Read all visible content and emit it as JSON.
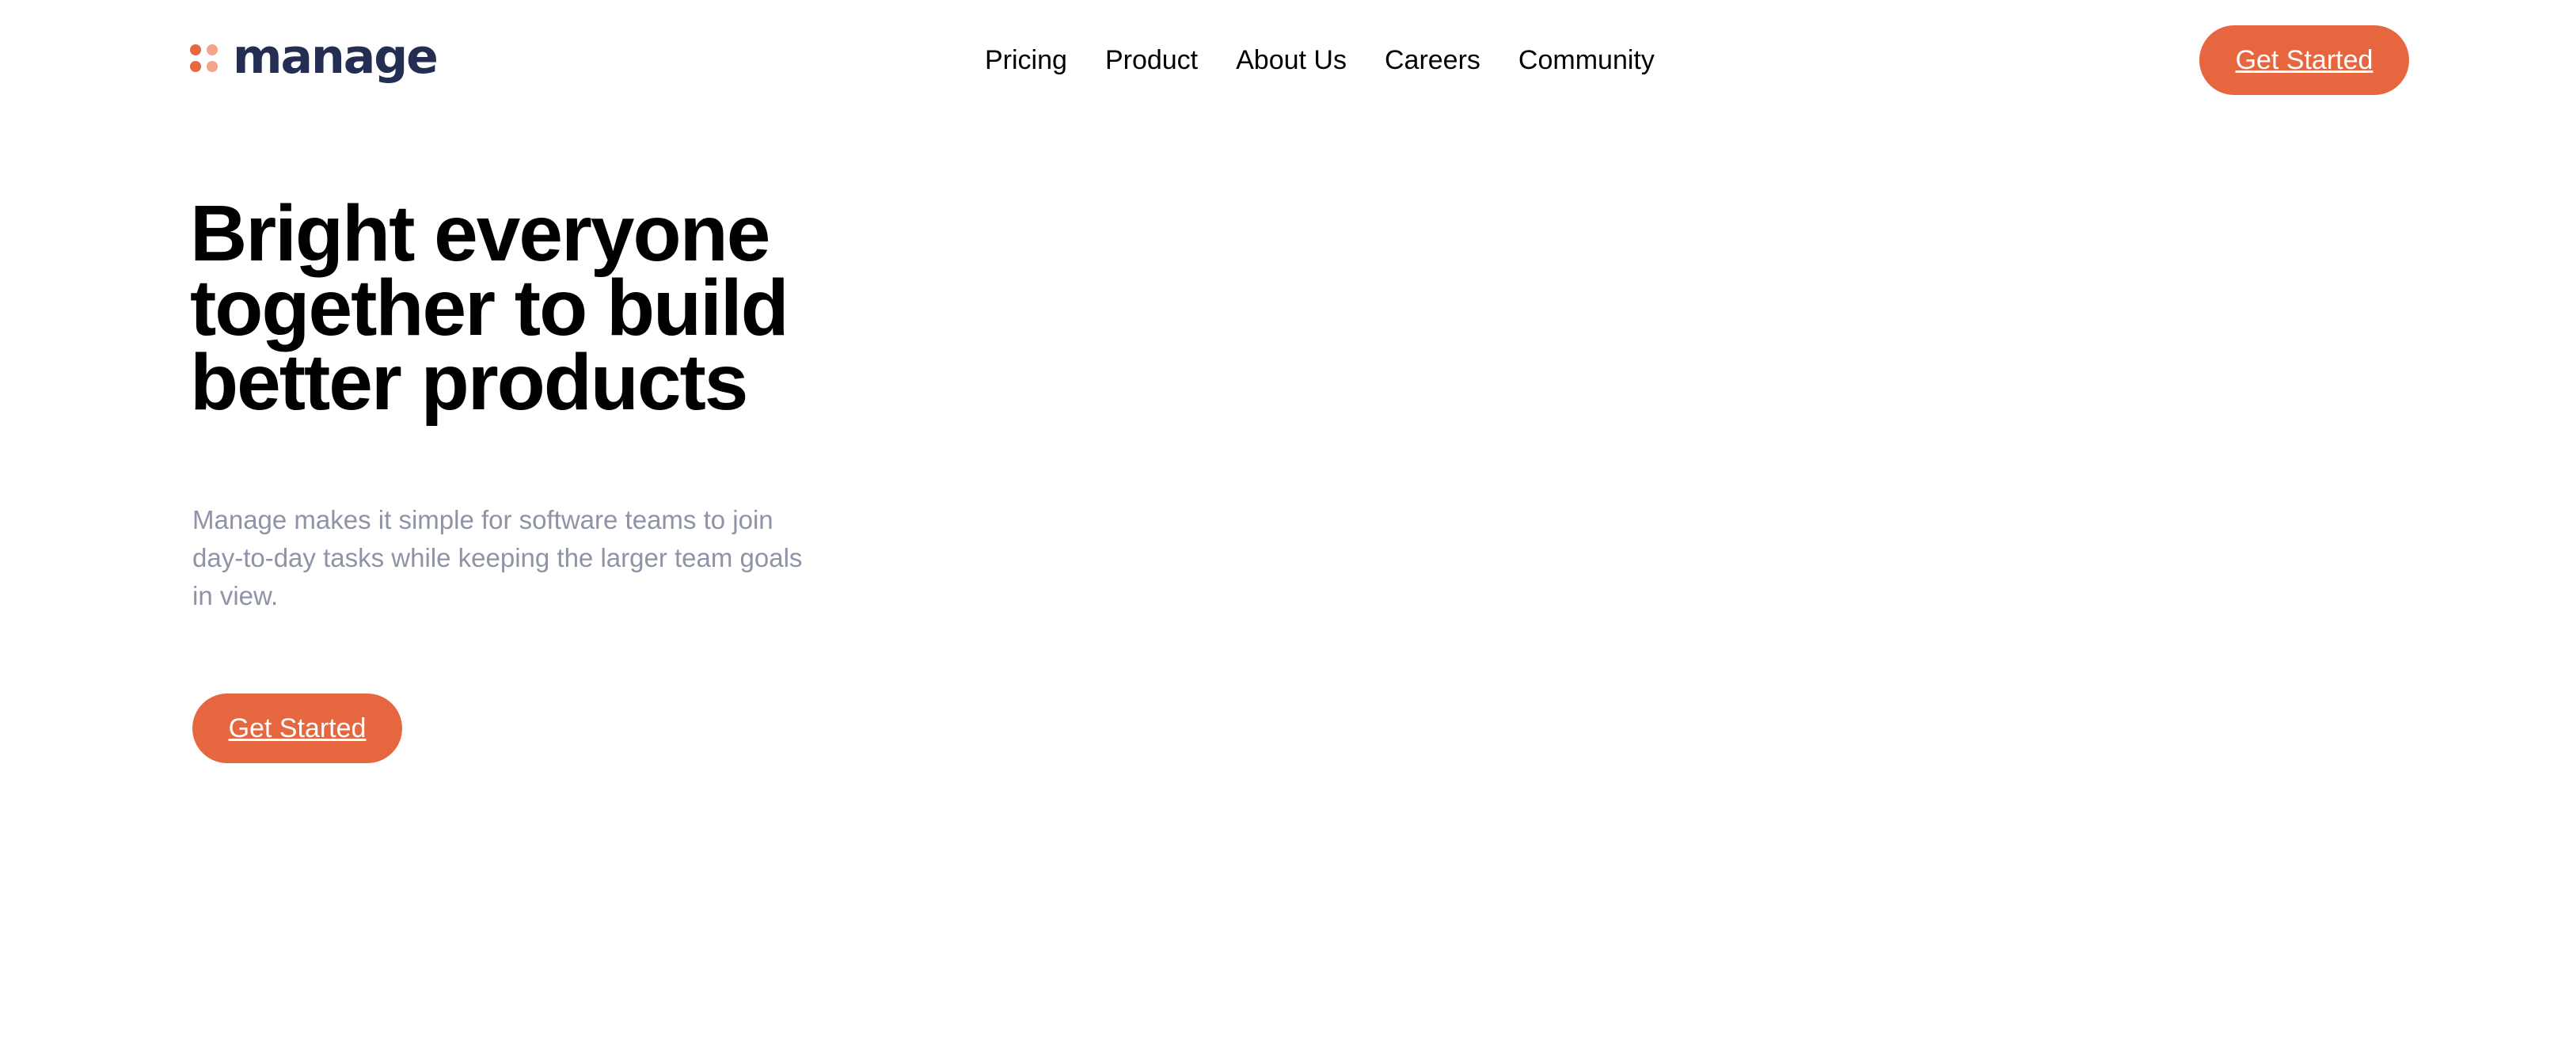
{
  "brand": {
    "name": "manage",
    "accent_color": "#E5663F",
    "accent_light_color": "#F4A48A",
    "text_dark_color": "#242D52",
    "muted_text_color": "#8E93A6"
  },
  "nav": {
    "items": [
      {
        "label": "Pricing"
      },
      {
        "label": "Product"
      },
      {
        "label": "About Us"
      },
      {
        "label": "Careers"
      },
      {
        "label": "Community"
      }
    ]
  },
  "header": {
    "cta_label": "Get Started"
  },
  "hero": {
    "title": "Bright everyone together to build better products",
    "description": "Manage makes it simple for software teams to join day-to-day tasks while keeping the larger team goals in view.",
    "cta_label": "Get Started"
  }
}
